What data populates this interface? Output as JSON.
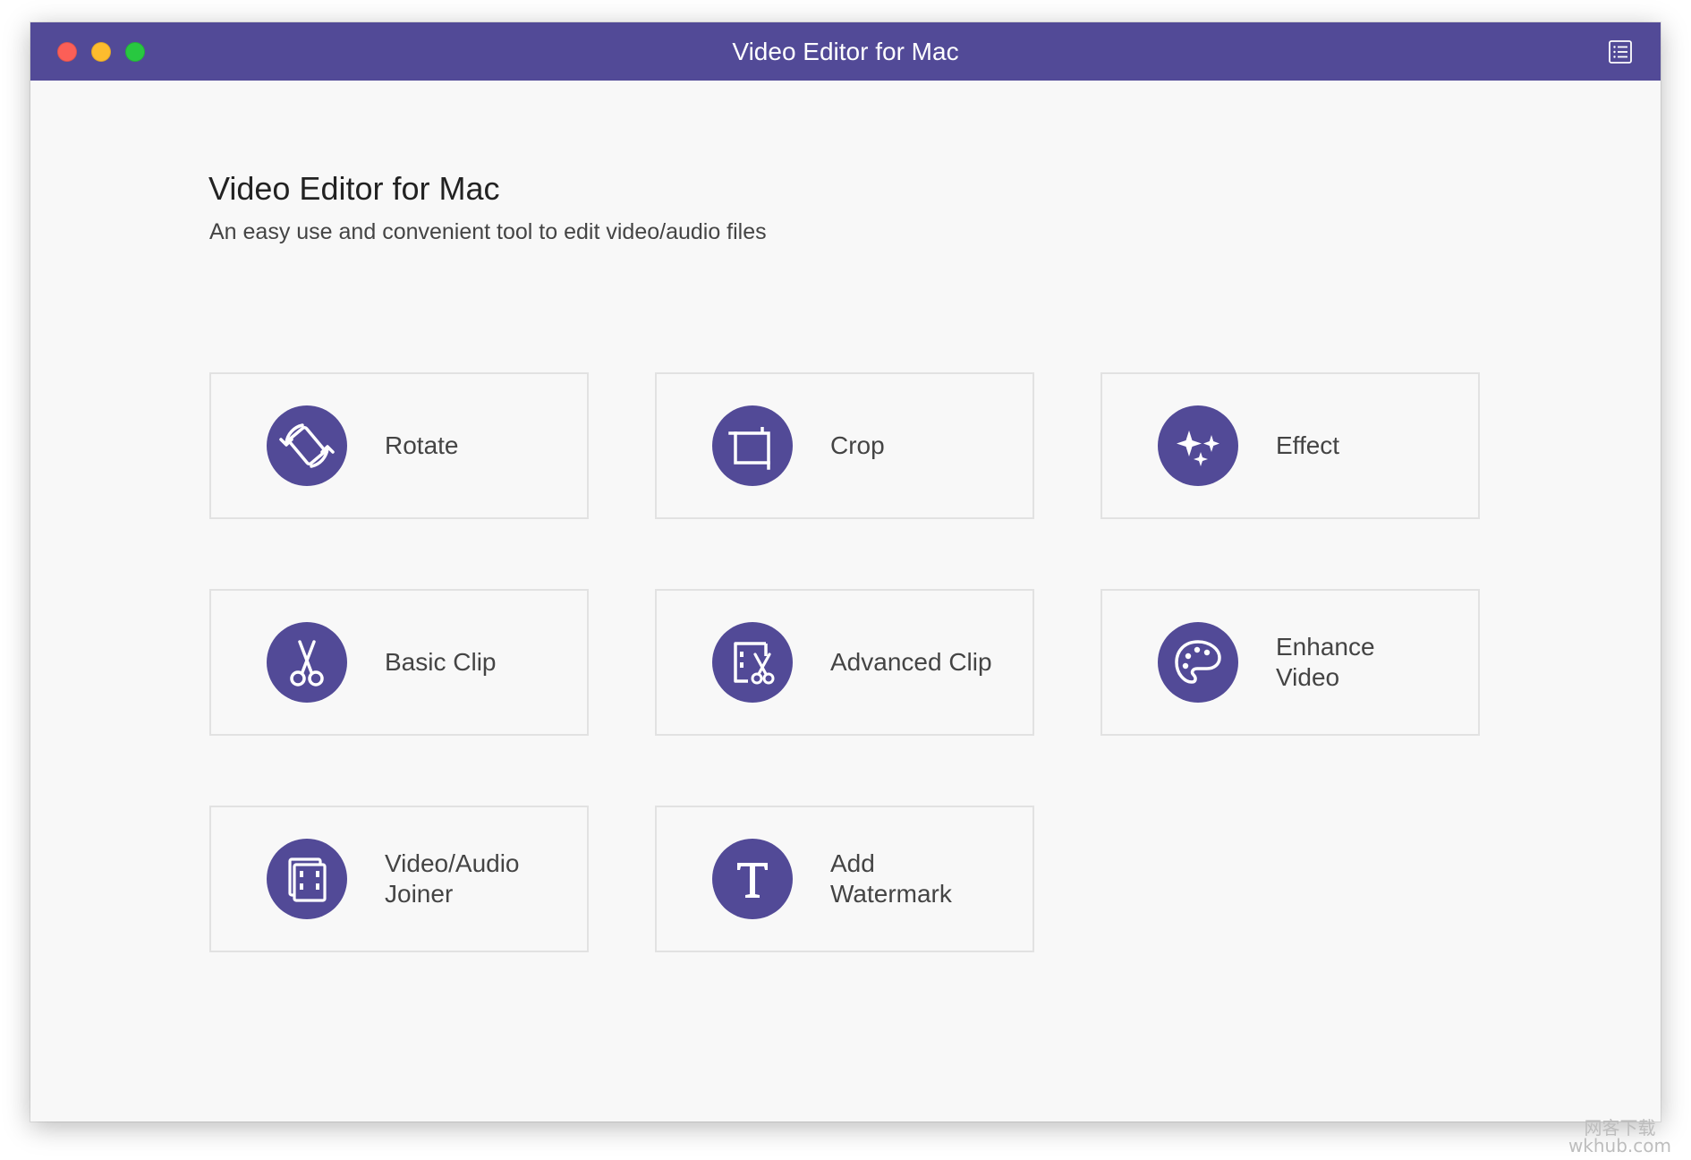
{
  "window": {
    "title": "Video Editor for Mac",
    "accent_color": "#524a97",
    "menu_icon": "list-icon"
  },
  "header": {
    "title": "Video Editor for Mac",
    "subtitle": "An easy use and convenient tool to edit video/audio files"
  },
  "tools": [
    {
      "label": "Rotate",
      "icon": "rotate-icon"
    },
    {
      "label": "Crop",
      "icon": "crop-icon"
    },
    {
      "label": "Effect",
      "icon": "sparkle-icon"
    },
    {
      "label": "Basic Clip",
      "icon": "scissors-icon"
    },
    {
      "label": "Advanced Clip",
      "icon": "film-scissors-icon"
    },
    {
      "label": "Enhance Video",
      "icon": "palette-icon"
    },
    {
      "label": "Video/Audio Joiner",
      "icon": "joiner-icon"
    },
    {
      "label": "Add Watermark",
      "icon": "text-t-icon"
    }
  ],
  "watermark": {
    "line1": "网客下载",
    "line2": "wkhub.com"
  }
}
